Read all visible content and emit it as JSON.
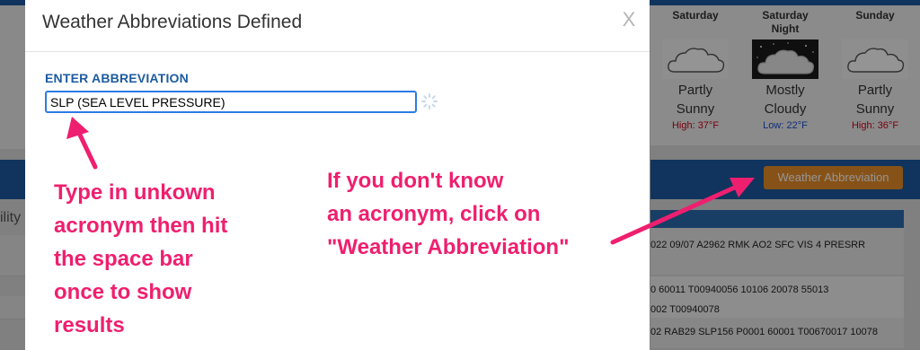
{
  "modal": {
    "title": "Weather Abbreviations Defined",
    "close_label": "X",
    "field_label": "ENTER ABBREVIATION",
    "input_value": "SLP (SEA LEVEL PRESSURE)"
  },
  "forecast": [
    {
      "day": "Saturday",
      "day2": "",
      "cond1": "Partly",
      "cond2": "Sunny",
      "temp": "High: 37°F",
      "temp_color": "#d0021b",
      "icon": "partly-sunny-icon"
    },
    {
      "day": "Saturday",
      "day2": "Night",
      "cond1": "Mostly",
      "cond2": "Cloudy",
      "temp": "Low: 22°F",
      "temp_color": "#1a4fd0",
      "icon": "mostly-cloudy-night-icon"
    },
    {
      "day": "Sunday",
      "day2": "",
      "cond1": "Partly",
      "cond2": "Sunny",
      "temp": "High: 36°F",
      "temp_color": "#d0021b",
      "icon": "partly-sunny-icon"
    }
  ],
  "weather_button_label": "Weather Abbreviation",
  "background": {
    "left_label": "ility",
    "rows": [
      "022 09/07 A2962 RMK AO2 SFC VIS 4 PRESRR",
      "0 60011 T00940056 10106 20078 55013",
      "02 RAB29 SLP156 P0001 60001 T00670017 10078"
    ],
    "row_prefix_mid": "002 T00940078"
  },
  "annotations": {
    "left_lines": [
      "Type in unkown",
      "acronym then hit",
      "the space bar",
      "once to show",
      "results"
    ],
    "right_lines": [
      "If you don't know",
      "an acronym, click on",
      "\"Weather Abbreviation\""
    ]
  },
  "colors": {
    "annotation": "#ef1f6f",
    "brand_blue": "#1d5ba0",
    "button_orange": "#e98d28",
    "input_focus": "#2c7be5"
  }
}
